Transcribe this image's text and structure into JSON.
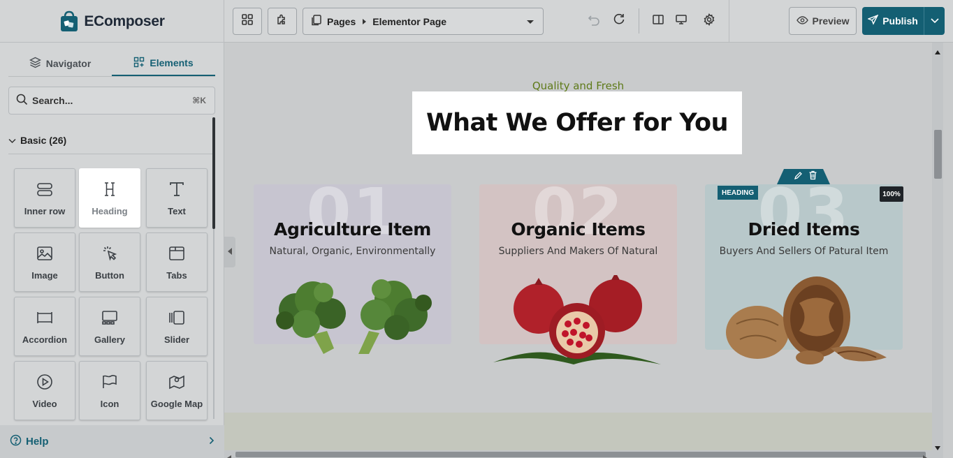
{
  "app": {
    "name": "EComposer",
    "brand_color": "#145f73"
  },
  "toolbar": {
    "breadcrumb_root": "Pages",
    "breadcrumb_page": "Elementor Page",
    "preview_label": "Preview",
    "publish_label": "Publish"
  },
  "sidebar": {
    "tabs": [
      {
        "label": "Navigator",
        "icon": "layers-icon",
        "active": false
      },
      {
        "label": "Elements",
        "icon": "elements-grid-icon",
        "active": true
      }
    ],
    "search": {
      "placeholder": "Search...",
      "shortcut": "⌘K"
    },
    "section_label": "Basic (26)",
    "elements": [
      {
        "label": "Inner row",
        "icon": "inner-row-icon"
      },
      {
        "label": "Heading",
        "icon": "heading-icon",
        "highlighted": true
      },
      {
        "label": "Text",
        "icon": "text-icon"
      },
      {
        "label": "Image",
        "icon": "image-icon"
      },
      {
        "label": "Button",
        "icon": "cursor-click-icon"
      },
      {
        "label": "Tabs",
        "icon": "tabs-icon"
      },
      {
        "label": "Accordion",
        "icon": "accordion-icon"
      },
      {
        "label": "Gallery",
        "icon": "gallery-icon"
      },
      {
        "label": "Slider",
        "icon": "slider-icon"
      },
      {
        "label": "Video",
        "icon": "play-circle-icon"
      },
      {
        "label": "Icon",
        "icon": "flag-icon"
      },
      {
        "label": "Google Map",
        "icon": "map-icon"
      }
    ],
    "help_label": "Help"
  },
  "canvas": {
    "eyebrow": "Quality and Fresh",
    "heading": "What We Offer for You",
    "selected_badge": "HEADING",
    "zoom_badge": "100%",
    "cards": [
      {
        "number": "01",
        "title": "Agriculture Item",
        "subtitle": "Natural, Organic, Environmentally",
        "bg": "#c7c5d0",
        "image": "broccoli"
      },
      {
        "number": "02",
        "title": "Organic Items",
        "subtitle": "Suppliers And Makers Of Natural",
        "bg": "#d3c3c3",
        "image": "pomegranate"
      },
      {
        "number": "03",
        "title": "Dried Items",
        "subtitle": "Buyers And Sellers Of Patural Item",
        "bg": "#b8c8ca",
        "image": "walnut"
      }
    ]
  }
}
